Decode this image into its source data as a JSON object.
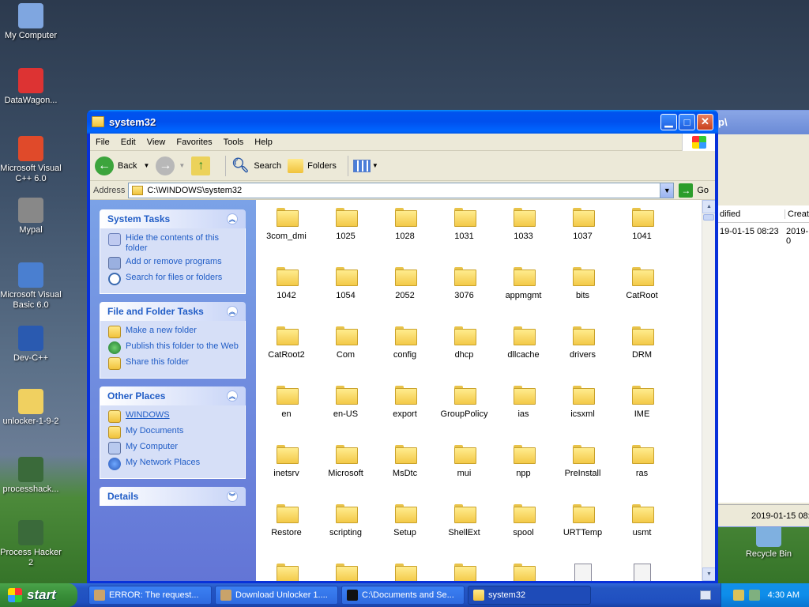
{
  "desktop_icons": [
    {
      "label": "My Computer",
      "icon": "my-computer-icon"
    },
    {
      "label": "DataWagon...",
      "icon": "datawagon-icon"
    },
    {
      "label": "Microsoft Visual C++ 6.0",
      "icon": "visual-cpp-icon"
    },
    {
      "label": "Mypal",
      "icon": "mypal-icon"
    },
    {
      "label": "Microsoft Visual Basic 6.0",
      "icon": "visual-basic-icon"
    },
    {
      "label": "Dev-C++",
      "icon": "dev-cpp-icon"
    },
    {
      "label": "unlocker-1-9-2",
      "icon": "zip-folder-icon"
    },
    {
      "label": "processhack...",
      "icon": "process-hacker-icon"
    },
    {
      "label": "Process Hacker 2",
      "icon": "process-hacker-icon"
    },
    {
      "label": "Recycle Bin",
      "icon": "recycle-bin-icon"
    }
  ],
  "bg_window": {
    "title": "p\\",
    "col_modified": "dified",
    "col_created": "Create",
    "row_modified": "19-01-15 08:23",
    "row_created": "2019-0",
    "status": "2019-01-15 08:"
  },
  "window": {
    "title": "system32"
  },
  "menu": [
    "File",
    "Edit",
    "View",
    "Favorites",
    "Tools",
    "Help"
  ],
  "toolbar": {
    "back": "Back",
    "search": "Search",
    "folders": "Folders"
  },
  "address": {
    "label": "Address",
    "value": "C:\\WINDOWS\\system32",
    "go": "Go"
  },
  "system_tasks": {
    "header": "System Tasks",
    "items": [
      "Hide the contents of this folder",
      "Add or remove programs",
      "Search for files or folders"
    ]
  },
  "file_tasks": {
    "header": "File and Folder Tasks",
    "items": [
      "Make a new folder",
      "Publish this folder to the Web",
      "Share this folder"
    ]
  },
  "other_places": {
    "header": "Other Places",
    "items": [
      "WINDOWS",
      "My Documents",
      "My Computer",
      "My Network Places"
    ]
  },
  "details": {
    "header": "Details"
  },
  "folders": [
    "3com_dmi",
    "1025",
    "1028",
    "1031",
    "1033",
    "1037",
    "1041",
    "1042",
    "1054",
    "2052",
    "3076",
    "appmgmt",
    "bits",
    "CatRoot",
    "CatRoot2",
    "Com",
    "config",
    "dhcp",
    "dllcache",
    "drivers",
    "DRM",
    "en",
    "en-US",
    "export",
    "GroupPolicy",
    "ias",
    "icsxml",
    "IME",
    "inetsrv",
    "Microsoft",
    "MsDtc",
    "mui",
    "npp",
    "PreInstall",
    "ras",
    "Restore",
    "scripting",
    "Setup",
    "ShellExt",
    "spool",
    "URTTemp",
    "usmt"
  ],
  "taskbar": {
    "start": "start",
    "tasks": [
      "ERROR: The request...",
      "Download Unlocker 1....",
      "C:\\Documents and Se...",
      "system32"
    ],
    "clock": "4:30 AM"
  }
}
